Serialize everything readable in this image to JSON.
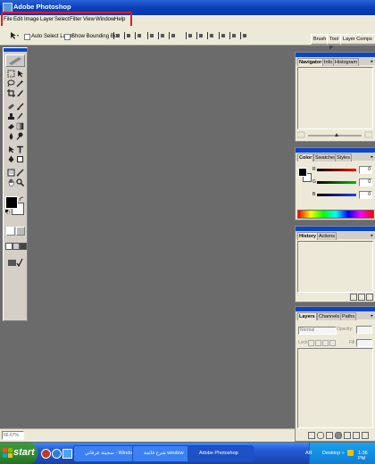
{
  "window": {
    "title": "Adobe Photoshop"
  },
  "menu": [
    "File",
    "Edit",
    "Image",
    "Layer",
    "Select",
    "Filter",
    "View",
    "Window",
    "Help"
  ],
  "options_bar": {
    "auto_select_label": "Auto Select Layer",
    "bounding_box_label": "Show Bounding Box",
    "well_tabs": [
      "Brush",
      "Tool P",
      "Layer Comps"
    ]
  },
  "navigator": {
    "tabs": [
      "Navigator",
      "Info",
      "Histogram"
    ]
  },
  "color": {
    "tabs": [
      "Color",
      "Swatches",
      "Styles"
    ],
    "channels": [
      {
        "label": "R",
        "value": "0",
        "color": "#d02020"
      },
      {
        "label": "G",
        "value": "0",
        "color": "#10a010"
      },
      {
        "label": "B",
        "value": "0",
        "color": "#2040d0"
      }
    ]
  },
  "history": {
    "tabs": [
      "History",
      "Actions"
    ]
  },
  "layers": {
    "tabs": [
      "Layers",
      "Channels",
      "Paths"
    ],
    "blend_mode": "Normal",
    "opacity_label": "Opacity:",
    "lock_label": "Lock:",
    "fill_label": "Fill:"
  },
  "status": {
    "zoom": "66.67%"
  },
  "taskbar": {
    "start_label": "start",
    "buttons": [
      "سجينة عرفاتي - Windo...",
      "شرح قائمة window",
      "Adobe Photoshop"
    ],
    "tray_lang": "AR",
    "tray_desktop": "Desktop",
    "clock": "1:36 PM"
  },
  "colors": {
    "accent": "#0a47c8",
    "highlight": "#e01a2a"
  }
}
